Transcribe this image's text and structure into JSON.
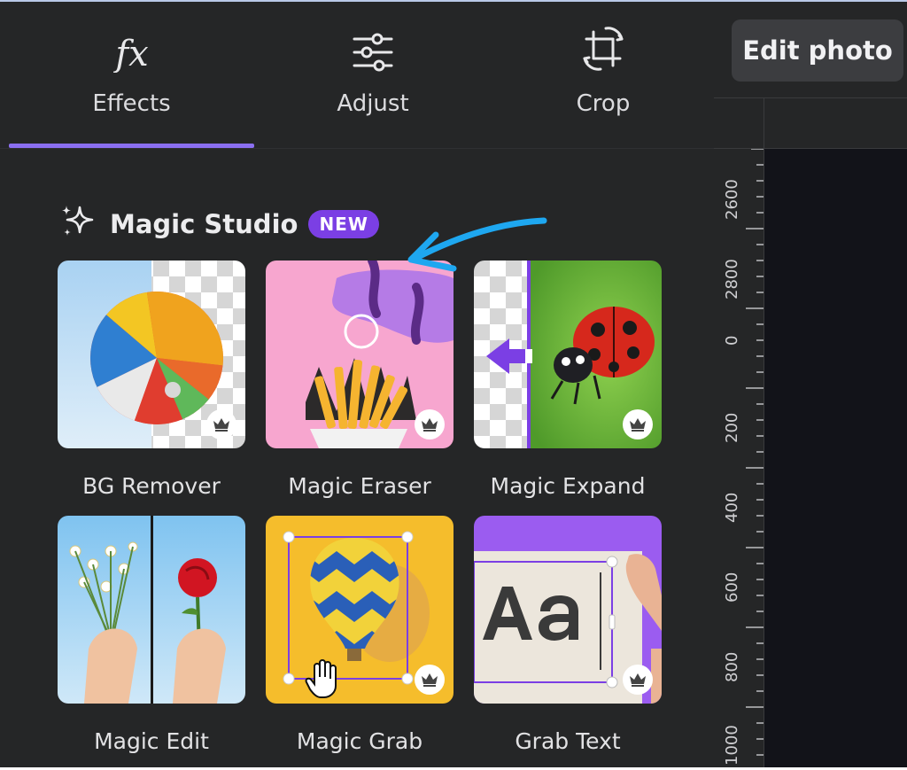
{
  "tabs": [
    {
      "label": "Effects",
      "icon": "fx-icon",
      "active": true
    },
    {
      "label": "Adjust",
      "icon": "sliders-icon",
      "active": false
    },
    {
      "label": "Crop",
      "icon": "crop-icon",
      "active": false
    }
  ],
  "section": {
    "title": "Magic Studio",
    "badge": "NEW",
    "icon": "sparkles-icon"
  },
  "tools": [
    {
      "label": "BG Remover",
      "premium": true
    },
    {
      "label": "Magic Eraser",
      "premium": true
    },
    {
      "label": "Magic Expand",
      "premium": true
    },
    {
      "label": "Magic Edit",
      "premium": false
    },
    {
      "label": "Magic Grab",
      "premium": true
    },
    {
      "label": "Grab Text",
      "premium": true
    }
  ],
  "header": {
    "edit_photo_label": "Edit photo"
  },
  "ruler": {
    "labels": [
      "2600",
      "2800",
      "0",
      "200",
      "400",
      "600",
      "800",
      "1000"
    ]
  },
  "colors": {
    "accent": "#8b6ff0",
    "badge": "#7b3fe4",
    "arrow": "#1ea7f0",
    "panel_bg": "#252627"
  },
  "annotation": {
    "arrow_icon": "blue-arrow-pointer-icon"
  }
}
